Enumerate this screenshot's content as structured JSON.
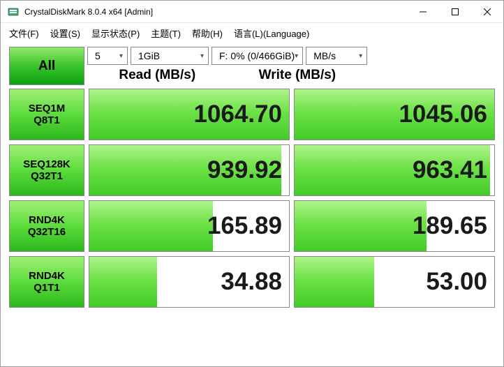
{
  "window": {
    "title": "CrystalDiskMark 8.0.4 x64 [Admin]"
  },
  "menu": {
    "file": "文件(F)",
    "settings": "设置(S)",
    "profile": "显示状态(P)",
    "theme": "主题(T)",
    "help": "帮助(H)",
    "language": "语言(L)(Language)"
  },
  "controls": {
    "all_label": "All",
    "count": "5",
    "size": "1GiB",
    "drive": "F: 0% (0/466GiB)",
    "unit": "MB/s"
  },
  "headers": {
    "read": "Read (MB/s)",
    "write": "Write (MB/s)"
  },
  "tests": [
    {
      "name1": "SEQ1M",
      "name2": "Q8T1",
      "read": "1064.70",
      "read_pct": 100,
      "write": "1045.06",
      "write_pct": 100
    },
    {
      "name1": "SEQ128K",
      "name2": "Q32T1",
      "read": "939.92",
      "read_pct": 96,
      "write": "963.41",
      "write_pct": 98
    },
    {
      "name1": "RND4K",
      "name2": "Q32T16",
      "read": "165.89",
      "read_pct": 62,
      "write": "189.65",
      "write_pct": 66
    },
    {
      "name1": "RND4K",
      "name2": "Q1T1",
      "read": "34.88",
      "read_pct": 34,
      "write": "53.00",
      "write_pct": 40
    }
  ]
}
